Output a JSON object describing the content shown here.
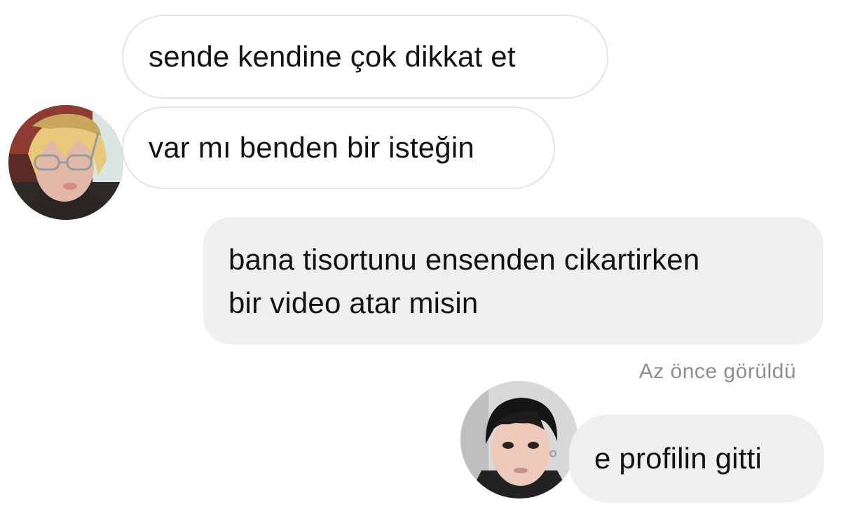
{
  "messages": [
    {
      "text": "sende kendine çok dikkat et",
      "direction": "incoming"
    },
    {
      "text": "var mı benden bir isteğin",
      "direction": "incoming"
    },
    {
      "lines": [
        "bana tisortunu ensenden cikartirken",
        "bir video atar misin"
      ],
      "direction": "outgoing"
    },
    {
      "text": "e profilin gitti",
      "direction": "incoming"
    }
  ],
  "seen_status": "Az önce görüldü",
  "colors": {
    "incoming_bubble": "#ffffff",
    "incoming_border": "#e3e3e3",
    "outgoing_bubble": "#efefef",
    "text": "#111111",
    "muted": "#8e8e8e"
  },
  "icons": {
    "avatar1": "profile-photo-blond-hair-glasses",
    "avatar2": "profile-photo-dark-hair"
  }
}
